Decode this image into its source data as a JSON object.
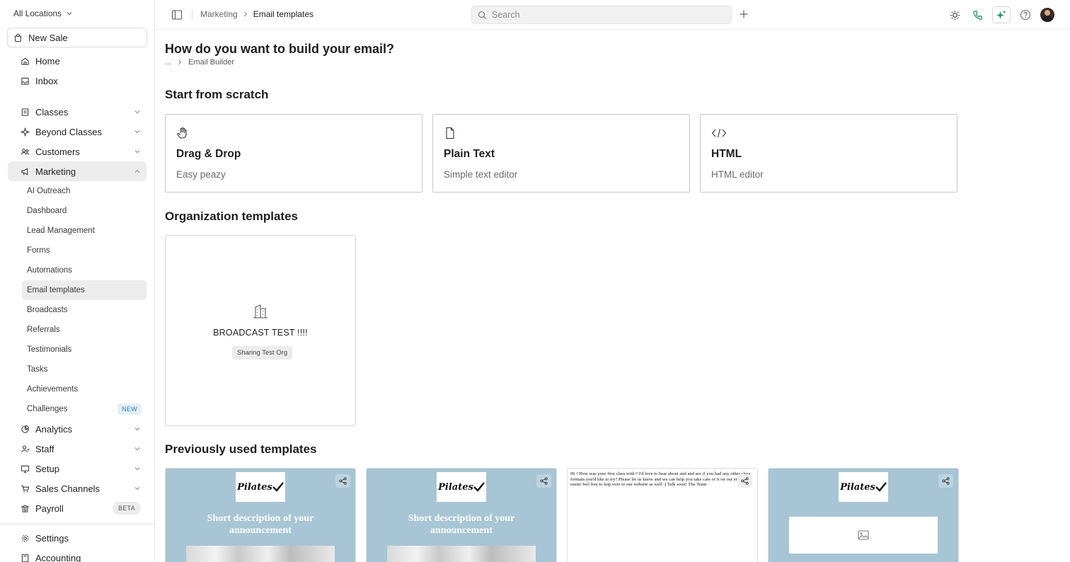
{
  "sidebar": {
    "location": "All Locations",
    "new_sale": "New Sale",
    "primary": [
      {
        "label": "Home"
      },
      {
        "label": "Inbox"
      }
    ],
    "sections": [
      {
        "label": "Classes"
      },
      {
        "label": "Beyond Classes"
      },
      {
        "label": "Customers"
      },
      {
        "label": "Marketing"
      }
    ],
    "marketing_items": [
      {
        "label": "AI Outreach"
      },
      {
        "label": "Dashboard"
      },
      {
        "label": "Lead Management"
      },
      {
        "label": "Forms"
      },
      {
        "label": "Automations"
      },
      {
        "label": "Email templates"
      },
      {
        "label": "Broadcasts"
      },
      {
        "label": "Referrals"
      },
      {
        "label": "Testimonials"
      },
      {
        "label": "Tasks"
      },
      {
        "label": "Achievements"
      },
      {
        "label": "Challenges",
        "badge": "NEW"
      }
    ],
    "lower_sections": [
      {
        "label": "Analytics"
      },
      {
        "label": "Staff"
      },
      {
        "label": "Setup"
      },
      {
        "label": "Sales Channels"
      },
      {
        "label": "Payroll",
        "badge": "BETA"
      }
    ],
    "bottom": [
      {
        "label": "Settings"
      },
      {
        "label": "Accounting"
      }
    ]
  },
  "topbar": {
    "breadcrumb_parent": "Marketing",
    "breadcrumb_current": "Email templates",
    "search_placeholder": "Search"
  },
  "page": {
    "title": "How do you want to build your email?",
    "sub_breadcrumb_ellipsis": "...",
    "sub_breadcrumb_current": "Email Builder",
    "scratch_heading": "Start from scratch",
    "scratch_options": [
      {
        "title": "Drag & Drop",
        "desc": "Easy peazy",
        "icon": "hand-icon"
      },
      {
        "title": "Plain Text",
        "desc": "Simple text editor",
        "icon": "file-icon"
      },
      {
        "title": "HTML",
        "desc": "HTML editor",
        "icon": "code-icon"
      }
    ],
    "org_heading": "Organization templates",
    "org_templates": [
      {
        "name": "BROADCAST TEST !!!!",
        "tag": "Sharing Test Org"
      }
    ],
    "prev_heading": "Previously used templates",
    "prev_templates": [
      {
        "logo": "Pilates",
        "headline": "Short description of your announcement"
      },
      {
        "logo": "Pilates",
        "headline": "Short description of your announcement"
      },
      {
        "text": "Hi ! How was your first class with ? I'd love to hear about and and see if you had any other class formats you'd like to try? Please let us know and we can help you take care of it on our end! If easier feel free to hop over to our website as well :) Talk soon! The Team"
      },
      {
        "logo": "Pilates"
      }
    ]
  },
  "colors": {
    "accent_green": "#1a8f5a",
    "template_bg": "#a7c5d4",
    "active_bg": "#ececec"
  }
}
